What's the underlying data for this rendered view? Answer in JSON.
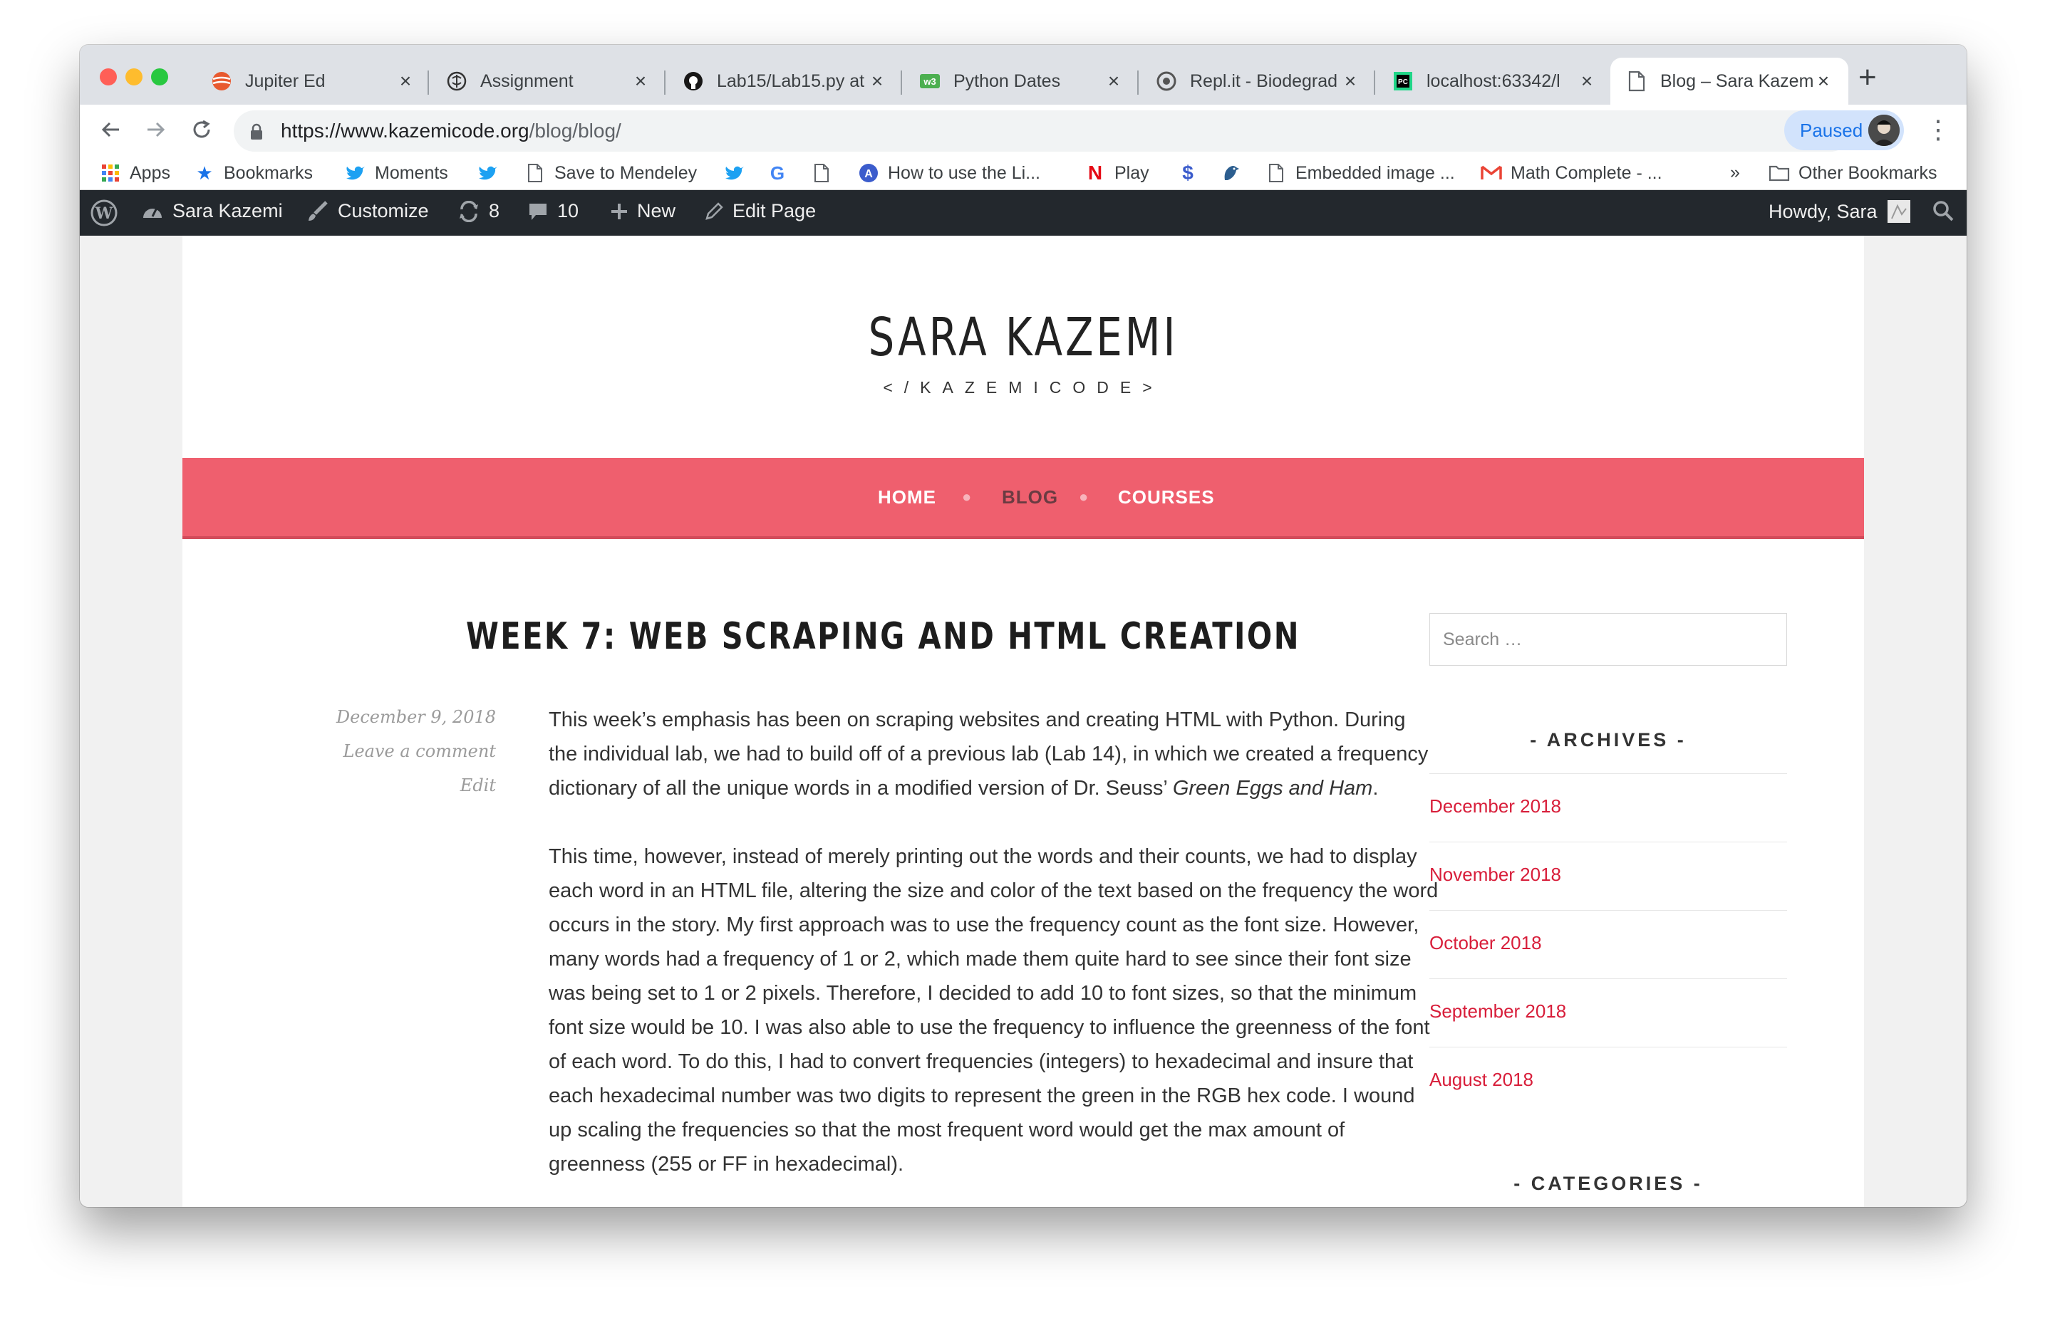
{
  "browser": {
    "tabs": [
      {
        "title": "Jupiter Ed",
        "icon": "jupiter-icon"
      },
      {
        "title": "Assignment",
        "icon": "brain-icon"
      },
      {
        "title": "Lab15/Lab15.py at",
        "icon": "github-icon"
      },
      {
        "title": "Python Dates",
        "icon": "w3schools-icon"
      },
      {
        "title": "Repl.it - Biodegrad",
        "icon": "replit-icon"
      },
      {
        "title": "localhost:63342/l",
        "icon": "pycharm-icon"
      },
      {
        "title": "Blog – Sara Kazemi",
        "icon": "page-icon"
      }
    ],
    "url_domain": "https://www.kazemicode.org",
    "url_path": "/blog/blog/",
    "profile_status": "Paused",
    "bookmarks": [
      {
        "label": "Apps",
        "icon": "apps-grid-icon"
      },
      {
        "label": "Bookmarks",
        "icon": "star-icon"
      },
      {
        "label": "Moments",
        "icon": "twitter-icon"
      },
      {
        "label": "",
        "icon": "twitter-icon"
      },
      {
        "label": "Save to Mendeley",
        "icon": "page-icon"
      },
      {
        "label": "",
        "icon": "twitter-icon"
      },
      {
        "label": "",
        "icon": "google-icon"
      },
      {
        "label": "",
        "icon": "page-icon"
      },
      {
        "label": "How to use the Li...",
        "icon": "a-circle-icon"
      },
      {
        "label": "Play",
        "icon": "netflix-icon"
      },
      {
        "label": "",
        "icon": "s-logo-icon"
      },
      {
        "label": "",
        "icon": "bird-icon"
      },
      {
        "label": "Embedded image ...",
        "icon": "page-icon"
      },
      {
        "label": "Math Complete - ...",
        "icon": "gmail-icon"
      }
    ],
    "overflow_chevron": "»",
    "other_bookmarks": "Other Bookmarks"
  },
  "wp_admin": {
    "site_name": "Sara Kazemi",
    "customize": "Customize",
    "updates": "8",
    "comments": "10",
    "new": "New",
    "edit_page": "Edit Page",
    "howdy": "Howdy, Sara"
  },
  "site": {
    "title": "SARA KAZEMI",
    "tagline": "</KAZEMICODE>",
    "nav": [
      "HOME",
      "BLOG",
      "COURSES"
    ],
    "nav_colors": {
      "default": "#ffffff",
      "current": "#6b3b42",
      "bar": "#ef5f6e"
    }
  },
  "post": {
    "title": "WEEK 7: WEB SCRAPING AND HTML CREATION",
    "date": "December 9, 2018",
    "comment_link": "Leave a comment",
    "edit_link": "Edit",
    "p1_a": "This week’s emphasis has been on scraping websites and creating HTML with Python. During the individual lab, we had to build off of a previous lab (Lab 14), in which we created a frequency dictionary of all the unique words in a modified version of Dr. Seuss’ ",
    "p1_em": "Green Eggs and Ham",
    "p1_b": ".",
    "p2": "This time, however, instead of merely printing out the words and their counts, we had to display each word in an HTML file, altering the size and color of the text based on the frequency the word occurs in the story. My first approach was to use the frequency count as the font size. However, many words had a frequency of 1 or 2, which made them quite hard to see since their font size was being set to 1 or 2 pixels. Therefore, I decided to add 10 to font sizes, so that the minimum font size would be 10. I was also able to use the frequency to influence the greenness of the font of each word. To do this, I had to convert frequencies (integers) to hexadecimal and insure that each hexadecimal number was two digits to represent the green in the RGB hex code. I wound up scaling the frequencies so that the most frequent word would get the max amount of greenness (255 or FF in hexadecimal)."
  },
  "sidebar": {
    "search_placeholder": "Search …",
    "archives_title": "- ARCHIVES -",
    "archives": [
      "December 2018",
      "November 2018",
      "October 2018",
      "September 2018",
      "August 2018"
    ],
    "categories_title": "- CATEGORIES -",
    "link_color": "#d81e3a"
  }
}
